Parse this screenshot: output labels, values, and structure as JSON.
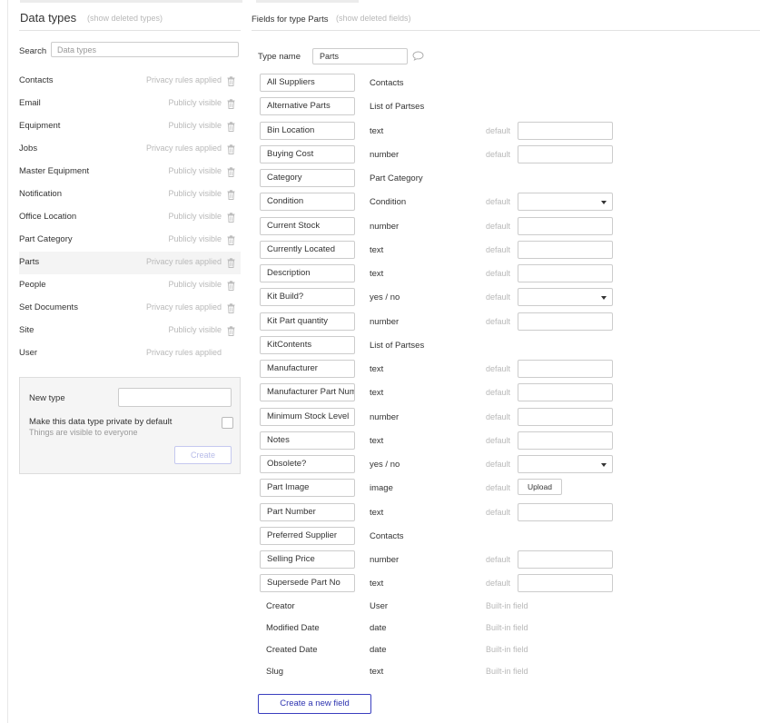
{
  "left_panel": {
    "title": "Data types",
    "show_deleted_link": "(show deleted types)",
    "search": {
      "label": "Search",
      "placeholder": "Data types",
      "value": ""
    },
    "types": [
      {
        "name": "Contacts",
        "status": "Privacy rules applied",
        "trash": true
      },
      {
        "name": "Email",
        "status": "Publicly visible",
        "trash": true
      },
      {
        "name": "Equipment",
        "status": "Publicly visible",
        "trash": true
      },
      {
        "name": "Jobs",
        "status": "Privacy rules applied",
        "trash": true
      },
      {
        "name": "Master Equipment",
        "status": "Publicly visible",
        "trash": true
      },
      {
        "name": "Notification",
        "status": "Publicly visible",
        "trash": true
      },
      {
        "name": "Office Location",
        "status": "Publicly visible",
        "trash": true
      },
      {
        "name": "Part Category",
        "status": "Publicly visible",
        "trash": true
      },
      {
        "name": "Parts",
        "status": "Privacy rules applied",
        "trash": true,
        "selected": true
      },
      {
        "name": "People",
        "status": "Publicly visible",
        "trash": true
      },
      {
        "name": "Set Documents",
        "status": "Privacy rules applied",
        "trash": true
      },
      {
        "name": "Site",
        "status": "Publicly visible",
        "trash": true
      },
      {
        "name": "User",
        "status": "Privacy rules applied",
        "trash": false
      }
    ],
    "new_type": {
      "label": "New type",
      "value": "",
      "private_label": "Make this data type private by default",
      "private_sublabel": "Things are visible to everyone",
      "private_checked": false,
      "create_button": "Create"
    }
  },
  "right_panel": {
    "title": "Fields for type Parts",
    "show_deleted_link": "(show deleted fields)",
    "type_name": {
      "label": "Type name",
      "value": "Parts"
    },
    "fields": [
      {
        "name": "All Suppliers",
        "type": "Contacts",
        "default": null
      },
      {
        "name": "Alternative Parts",
        "type": "List of Partses",
        "default": null
      },
      {
        "name": "Bin Location",
        "type": "text",
        "default": "input"
      },
      {
        "name": "Buying Cost",
        "type": "number",
        "default": "input"
      },
      {
        "name": "Category",
        "type": "Part Category",
        "default": null
      },
      {
        "name": "Condition",
        "type": "Condition",
        "default": "select"
      },
      {
        "name": "Current Stock",
        "type": "number",
        "default": "input"
      },
      {
        "name": "Currently Located",
        "type": "text",
        "default": "input"
      },
      {
        "name": "Description",
        "type": "text",
        "default": "input"
      },
      {
        "name": "Kit Build?",
        "type": "yes / no",
        "default": "select"
      },
      {
        "name": "Kit Part quantity",
        "type": "number",
        "default": "input"
      },
      {
        "name": "KitContents",
        "type": "List of Partses",
        "default": null
      },
      {
        "name": "Manufacturer",
        "type": "text",
        "default": "input"
      },
      {
        "name": "Manufacturer Part Number",
        "type": "text",
        "default": "input"
      },
      {
        "name": "Minimum Stock Level",
        "type": "number",
        "default": "input"
      },
      {
        "name": "Notes",
        "type": "text",
        "default": "input"
      },
      {
        "name": "Obsolete?",
        "type": "yes / no",
        "default": "select"
      },
      {
        "name": "Part Image",
        "type": "image",
        "default": "upload"
      },
      {
        "name": "Part Number",
        "type": "text",
        "default": "input"
      },
      {
        "name": "Preferred Supplier",
        "type": "Contacts",
        "default": null
      },
      {
        "name": "Selling Price",
        "type": "number",
        "default": "input"
      },
      {
        "name": "Supersede Part No",
        "type": "text",
        "default": "input"
      }
    ],
    "default_label": "default",
    "upload_label": "Upload",
    "builtin_fields": [
      {
        "name": "Creator",
        "type": "User",
        "note": "Built-in field"
      },
      {
        "name": "Modified Date",
        "type": "date",
        "note": "Built-in field"
      },
      {
        "name": "Created Date",
        "type": "date",
        "note": "Built-in field"
      },
      {
        "name": "Slug",
        "type": "text",
        "note": "Built-in field"
      }
    ],
    "new_field_button": "Create a new field"
  },
  "colors": {
    "accent": "#2e34b0",
    "muted_text": "#b8b8b8",
    "border": "#cccccc",
    "selected_row": "#f4f4f4"
  }
}
